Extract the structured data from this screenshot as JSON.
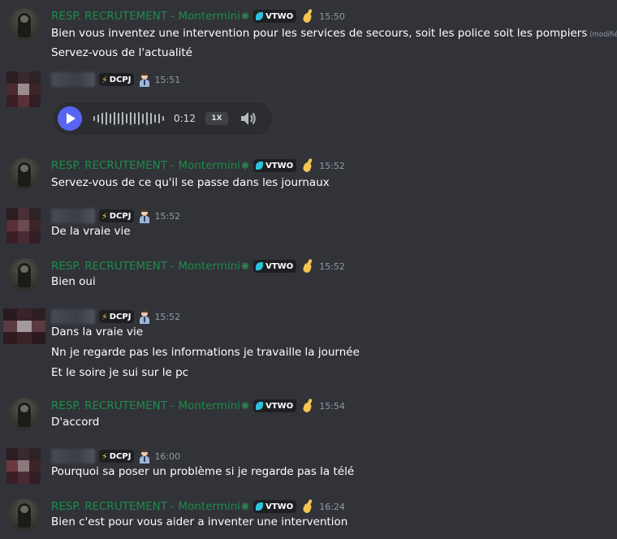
{
  "recruiter": {
    "name": "RESP. RECRUTEMENT - Montermini",
    "name_suffix_icon": "leaf-icon",
    "tag": "VTWO",
    "tag_icon": "vtwo-badge-icon",
    "badge_icon": "pinched-hand-emoji",
    "name_color": "#1f8b4c"
  },
  "applicant": {
    "name_blurred": true,
    "tag": "DCPJ",
    "tag_icon": "lightning-icon",
    "badge_icon": "businessman-emoji"
  },
  "messages": [
    {
      "author": "recruiter",
      "time": "15:50",
      "lines": [
        "Bien vous inventez une intervention pour les services de secours, soit les police soit les pompiers",
        "Servez-vous de l'actualité"
      ],
      "edited_label": "(modifié)"
    },
    {
      "author": "applicant",
      "time": "15:51",
      "voice": {
        "duration": "0:12",
        "speed": "1X",
        "play_icon": "play-icon",
        "volume_icon": "volume-icon"
      }
    },
    {
      "author": "recruiter",
      "time": "15:52",
      "lines": [
        "Servez-vous de ce qu'il se passe dans les journaux"
      ]
    },
    {
      "author": "applicant",
      "time": "15:52",
      "lines": [
        "De la vraie vie"
      ]
    },
    {
      "author": "recruiter",
      "time": "15:52",
      "lines": [
        "Bien oui"
      ]
    },
    {
      "author": "applicant",
      "time": "15:52",
      "lines": [
        "Dans la vraie vie",
        "Nn je regarde pas les informations je travaille la journée",
        "Et le soire je sui sur le pc"
      ]
    },
    {
      "author": "recruiter",
      "time": "15:54",
      "lines": [
        "D'accord"
      ]
    },
    {
      "author": "applicant",
      "time": "16:00",
      "lines": [
        "Pourquoi sa poser un problème si je regarde pas la télé"
      ]
    },
    {
      "author": "recruiter",
      "time": "16:24",
      "lines": [
        "Bien c'est pour vous aider a inventer  une intervention"
      ]
    }
  ]
}
